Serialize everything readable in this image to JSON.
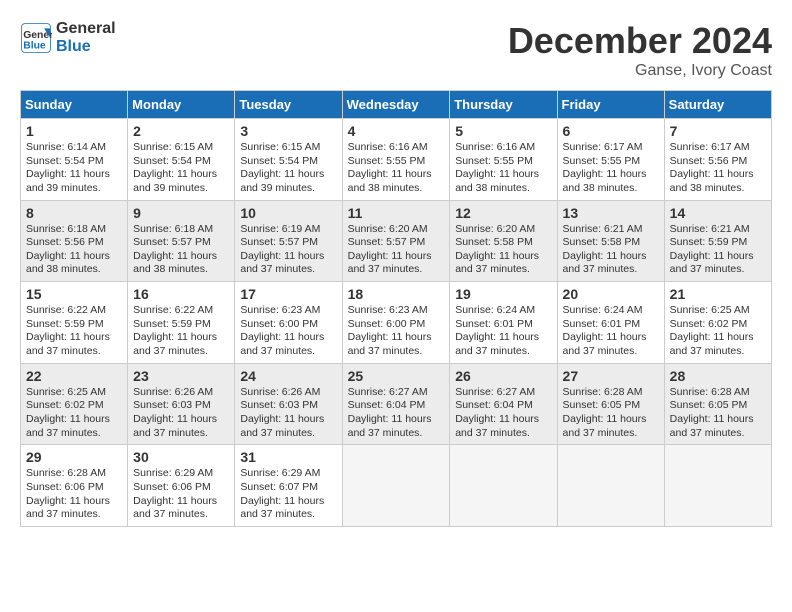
{
  "header": {
    "logo_line1": "General",
    "logo_line2": "Blue",
    "title": "December 2024",
    "subtitle": "Ganse, Ivory Coast"
  },
  "calendar": {
    "days_of_week": [
      "Sunday",
      "Monday",
      "Tuesday",
      "Wednesday",
      "Thursday",
      "Friday",
      "Saturday"
    ],
    "weeks": [
      [
        {
          "day": "",
          "empty": true
        },
        {
          "day": "",
          "empty": true
        },
        {
          "day": "",
          "empty": true
        },
        {
          "day": "",
          "empty": true
        },
        {
          "day": "",
          "empty": true
        },
        {
          "day": "",
          "empty": true
        },
        {
          "day": "",
          "empty": true
        }
      ],
      [
        {
          "day": "1",
          "sunrise": "6:14 AM",
          "sunset": "5:54 PM",
          "daylight": "11 hours and 39 minutes."
        },
        {
          "day": "2",
          "sunrise": "6:15 AM",
          "sunset": "5:54 PM",
          "daylight": "11 hours and 39 minutes."
        },
        {
          "day": "3",
          "sunrise": "6:15 AM",
          "sunset": "5:54 PM",
          "daylight": "11 hours and 39 minutes."
        },
        {
          "day": "4",
          "sunrise": "6:16 AM",
          "sunset": "5:55 PM",
          "daylight": "11 hours and 38 minutes."
        },
        {
          "day": "5",
          "sunrise": "6:16 AM",
          "sunset": "5:55 PM",
          "daylight": "11 hours and 38 minutes."
        },
        {
          "day": "6",
          "sunrise": "6:17 AM",
          "sunset": "5:55 PM",
          "daylight": "11 hours and 38 minutes."
        },
        {
          "day": "7",
          "sunrise": "6:17 AM",
          "sunset": "5:56 PM",
          "daylight": "11 hours and 38 minutes."
        }
      ],
      [
        {
          "day": "8",
          "sunrise": "6:18 AM",
          "sunset": "5:56 PM",
          "daylight": "11 hours and 38 minutes."
        },
        {
          "day": "9",
          "sunrise": "6:18 AM",
          "sunset": "5:57 PM",
          "daylight": "11 hours and 38 minutes."
        },
        {
          "day": "10",
          "sunrise": "6:19 AM",
          "sunset": "5:57 PM",
          "daylight": "11 hours and 37 minutes."
        },
        {
          "day": "11",
          "sunrise": "6:20 AM",
          "sunset": "5:57 PM",
          "daylight": "11 hours and 37 minutes."
        },
        {
          "day": "12",
          "sunrise": "6:20 AM",
          "sunset": "5:58 PM",
          "daylight": "11 hours and 37 minutes."
        },
        {
          "day": "13",
          "sunrise": "6:21 AM",
          "sunset": "5:58 PM",
          "daylight": "11 hours and 37 minutes."
        },
        {
          "day": "14",
          "sunrise": "6:21 AM",
          "sunset": "5:59 PM",
          "daylight": "11 hours and 37 minutes."
        }
      ],
      [
        {
          "day": "15",
          "sunrise": "6:22 AM",
          "sunset": "5:59 PM",
          "daylight": "11 hours and 37 minutes."
        },
        {
          "day": "16",
          "sunrise": "6:22 AM",
          "sunset": "5:59 PM",
          "daylight": "11 hours and 37 minutes."
        },
        {
          "day": "17",
          "sunrise": "6:23 AM",
          "sunset": "6:00 PM",
          "daylight": "11 hours and 37 minutes."
        },
        {
          "day": "18",
          "sunrise": "6:23 AM",
          "sunset": "6:00 PM",
          "daylight": "11 hours and 37 minutes."
        },
        {
          "day": "19",
          "sunrise": "6:24 AM",
          "sunset": "6:01 PM",
          "daylight": "11 hours and 37 minutes."
        },
        {
          "day": "20",
          "sunrise": "6:24 AM",
          "sunset": "6:01 PM",
          "daylight": "11 hours and 37 minutes."
        },
        {
          "day": "21",
          "sunrise": "6:25 AM",
          "sunset": "6:02 PM",
          "daylight": "11 hours and 37 minutes."
        }
      ],
      [
        {
          "day": "22",
          "sunrise": "6:25 AM",
          "sunset": "6:02 PM",
          "daylight": "11 hours and 37 minutes."
        },
        {
          "day": "23",
          "sunrise": "6:26 AM",
          "sunset": "6:03 PM",
          "daylight": "11 hours and 37 minutes."
        },
        {
          "day": "24",
          "sunrise": "6:26 AM",
          "sunset": "6:03 PM",
          "daylight": "11 hours and 37 minutes."
        },
        {
          "day": "25",
          "sunrise": "6:27 AM",
          "sunset": "6:04 PM",
          "daylight": "11 hours and 37 minutes."
        },
        {
          "day": "26",
          "sunrise": "6:27 AM",
          "sunset": "6:04 PM",
          "daylight": "11 hours and 37 minutes."
        },
        {
          "day": "27",
          "sunrise": "6:28 AM",
          "sunset": "6:05 PM",
          "daylight": "11 hours and 37 minutes."
        },
        {
          "day": "28",
          "sunrise": "6:28 AM",
          "sunset": "6:05 PM",
          "daylight": "11 hours and 37 minutes."
        }
      ],
      [
        {
          "day": "29",
          "sunrise": "6:28 AM",
          "sunset": "6:06 PM",
          "daylight": "11 hours and 37 minutes."
        },
        {
          "day": "30",
          "sunrise": "6:29 AM",
          "sunset": "6:06 PM",
          "daylight": "11 hours and 37 minutes."
        },
        {
          "day": "31",
          "sunrise": "6:29 AM",
          "sunset": "6:07 PM",
          "daylight": "11 hours and 37 minutes."
        },
        {
          "day": "",
          "empty": true
        },
        {
          "day": "",
          "empty": true
        },
        {
          "day": "",
          "empty": true
        },
        {
          "day": "",
          "empty": true
        }
      ]
    ]
  }
}
